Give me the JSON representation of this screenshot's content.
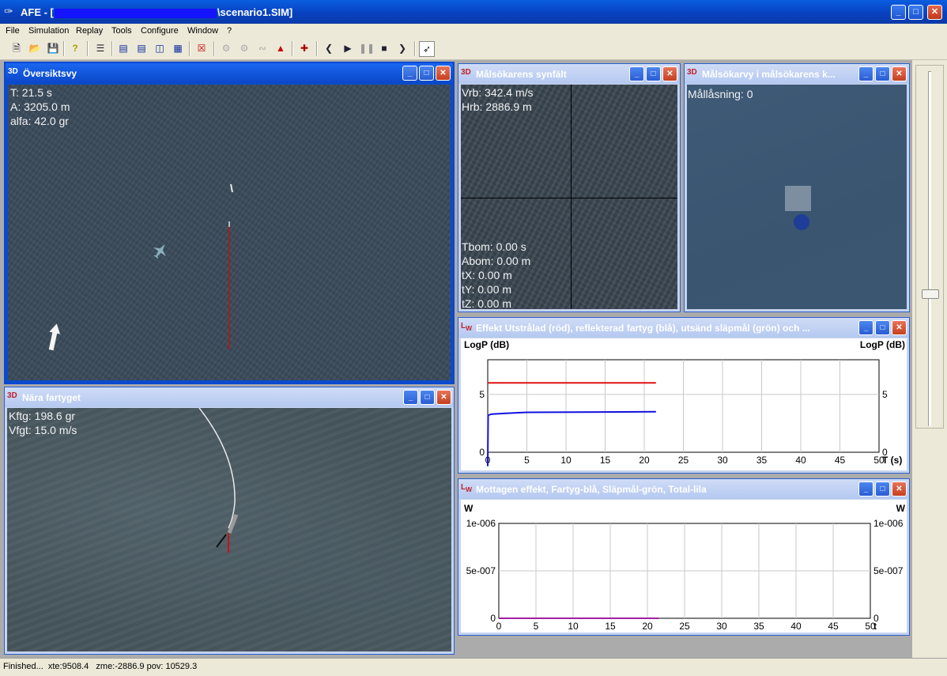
{
  "app": {
    "title_prefix": "AFE - [",
    "title_suffix": "\\scenario1.SIM]"
  },
  "menu": [
    "File",
    "Simulation",
    "Replay",
    "Tools",
    "Configure",
    "Window",
    "?"
  ],
  "toolbar": {
    "icons": [
      "new-file-icon",
      "open-folder-icon",
      "save-icon",
      "help-icon",
      "scenario-icon",
      "cascade-icon",
      "tile-horizontal-icon",
      "tile-vertical-icon",
      "arrange-icon",
      "delete-icon",
      "disabled-tool-1-icon",
      "disabled-tool-2-icon",
      "disabled-tool-3-icon",
      "record-icon",
      "add-object-icon",
      "step-back-icon",
      "play-icon",
      "pause-icon",
      "stop-icon",
      "step-forward-icon",
      "pin-icon"
    ]
  },
  "windows": {
    "overview": {
      "title": "Översiktsvy",
      "lines": [
        "T: 21.5 s",
        "A: 3205.0 m",
        "alfa: 42.0 gr"
      ]
    },
    "near_ship": {
      "title": "Nära fartyget",
      "lines": [
        "Kftg: 198.6 gr",
        "Vfgt: 15.0 m/s"
      ]
    },
    "seeker_fov": {
      "title": "Målsökarens synfält",
      "top_lines": [
        "Vrb: 342.4 m/s",
        "Hrb: 2886.9 m"
      ],
      "bottom_lines": [
        "Tbom: 0.00 s",
        "Abom: 0.00 m",
        "tX: 0.00 m",
        "tY: 0.00 m",
        "tZ: 0.00 m"
      ]
    },
    "seeker_target": {
      "title": "Målsökarvy i målsökarens k...",
      "lines": [
        "Mållåsning: 0"
      ]
    },
    "power_chart": {
      "title": "Effekt Utstrålad (röd), reflekterad fartyg (blå), utsänd släpmål (grön) och ..."
    },
    "received_chart": {
      "title": "Mottagen effekt, Fartyg-blå, Släpmål-grön, Total-lila"
    }
  },
  "colors": {
    "red": "#e01010",
    "blue": "#1010e0",
    "purple": "#a020a0"
  },
  "chart_data": [
    {
      "type": "line",
      "x_label": "T (s)",
      "ylabel_left": "LogP (dB)",
      "ylabel_right": "LogP (dB)",
      "xlim": [
        0,
        50
      ],
      "ylim": [
        0,
        8
      ],
      "x_ticks": [
        "0",
        "5",
        "10",
        "15",
        "20",
        "25",
        "30",
        "35",
        "40",
        "45",
        "50"
      ],
      "y_ticks": [
        "0",
        "5"
      ],
      "grid": true,
      "series": [
        {
          "color": "#e01010",
          "points": [
            [
              0,
              6.0
            ],
            [
              21.5,
              6.0
            ]
          ]
        },
        {
          "color": "#1010e0",
          "points": [
            [
              0,
              -1.2
            ],
            [
              0.05,
              3.2
            ],
            [
              0.5,
              3.3
            ],
            [
              5,
              3.45
            ],
            [
              21.5,
              3.5
            ]
          ]
        }
      ]
    },
    {
      "type": "line",
      "x_label": "t",
      "ylabel_left": "W",
      "ylabel_right": "W",
      "xlim": [
        0,
        50
      ],
      "ylim": [
        0,
        1e-06
      ],
      "x_ticks": [
        "0",
        "5",
        "10",
        "15",
        "20",
        "25",
        "30",
        "35",
        "40",
        "45",
        "50"
      ],
      "y_ticks": [
        "0",
        "5e-007",
        "1e-006"
      ],
      "grid": true,
      "series": [
        {
          "color": "#a020a0",
          "points": [
            [
              0,
              0
            ],
            [
              21.5,
              0
            ]
          ]
        }
      ]
    }
  ],
  "status": {
    "text": "Finished...  xte:9508.4   zme:-2886.9 pov: 10529.3"
  }
}
